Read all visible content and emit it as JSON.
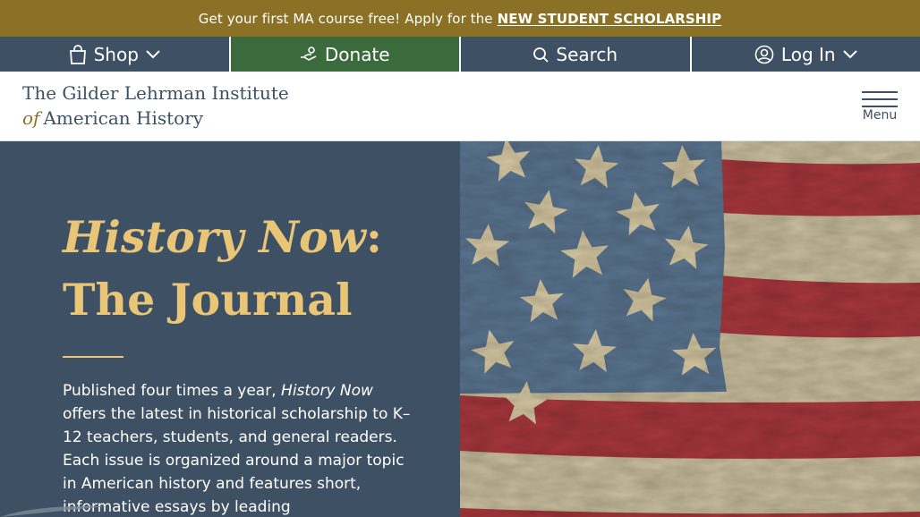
{
  "announcement": {
    "text": "Get your first MA course free! Apply for the",
    "link": "NEW STUDENT SCHOLARSHIP"
  },
  "utility_nav": {
    "shop": "Shop",
    "donate": "Donate",
    "search": "Search",
    "login": "Log In"
  },
  "header": {
    "logo_line1": "The Gilder Lehrman Institute",
    "logo_of": "of",
    "logo_line2": "American History",
    "menu_label": "Menu"
  },
  "hero": {
    "title_italic": "History Now",
    "title_colon": ":",
    "title_line2": "The Journal",
    "body_prefix": "Published four times a year, ",
    "body_italic": "History Now",
    "body_rest": " offers the latest in historical scholarship to K–12 teachers, students, and general readers. Each issue is organized around a major topic in American history and features short, informative essays by leading"
  },
  "colors": {
    "announce_bg": "#8a7126",
    "nav_bg": "#3e5064",
    "donate_bg": "#3b6a3c",
    "hero_title": "#e9c677",
    "flag_red": "#a8373d",
    "flag_blue": "#5a7590",
    "flag_cream": "#cfc3a2"
  },
  "icons": [
    "shopping-bag-icon",
    "chevron-down-icon",
    "donate-hand-icon",
    "search-icon",
    "user-circle-icon",
    "hamburger-icon"
  ]
}
